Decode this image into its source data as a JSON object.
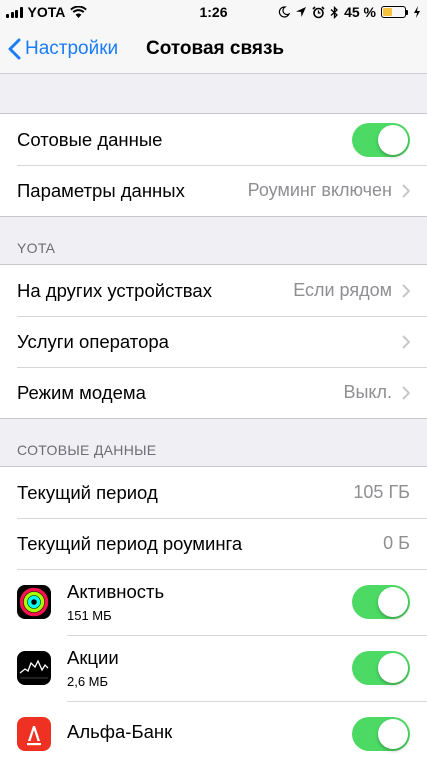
{
  "status_bar": {
    "carrier": "YOTA",
    "time": "1:26",
    "battery_percent": "45 %",
    "battery_level": 0.45
  },
  "nav": {
    "back_label": "Настройки",
    "title": "Сотовая связь"
  },
  "group1": {
    "cellular_data_label": "Сотовые данные",
    "cellular_data_on": true,
    "data_options_label": "Параметры данных",
    "data_options_value": "Роуминг включен"
  },
  "carrier_section": {
    "header": "YOTA",
    "other_devices_label": "На других устройствах",
    "other_devices_value": "Если рядом",
    "carrier_services_label": "Услуги оператора",
    "hotspot_label": "Режим модема",
    "hotspot_value": "Выкл."
  },
  "usage_section": {
    "header": "СОТОВЫЕ ДАННЫЕ",
    "current_period_label": "Текущий период",
    "current_period_value": "105 ГБ",
    "roaming_period_label": "Текущий период роуминга",
    "roaming_period_value": "0 Б"
  },
  "apps": [
    {
      "name": "Активность",
      "size": "151 МБ",
      "icon": "activity-rings-icon",
      "enabled": true
    },
    {
      "name": "Акции",
      "size": "2,6 МБ",
      "icon": "stocks-chart-icon",
      "enabled": true
    },
    {
      "name": "Альфа-Банк",
      "size": "",
      "icon": "alfa-bank-icon",
      "enabled": true
    }
  ],
  "colors": {
    "accent": "#1a7cf8",
    "toggle_on": "#4cd964",
    "background": "#efeff4"
  }
}
